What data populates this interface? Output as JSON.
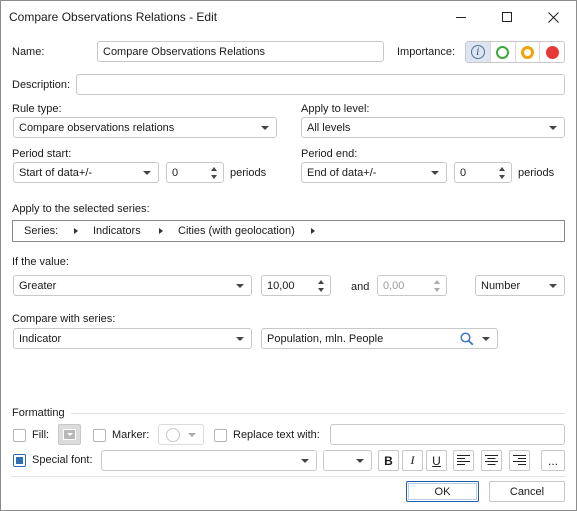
{
  "window": {
    "title": "Compare Observations Relations - Edit"
  },
  "name": {
    "label": "Name:",
    "value": "Compare Observations Relations"
  },
  "importance": {
    "label": "Importance:",
    "options": [
      "info",
      "low",
      "medium",
      "high"
    ],
    "colors": {
      "low": "#3aa83a",
      "medium": "#f0a30a",
      "high": "#e53935"
    }
  },
  "description": {
    "label": "Description:",
    "value": ""
  },
  "rule_type": {
    "label": "Rule type:",
    "value": "Compare observations relations"
  },
  "apply_to_level": {
    "label": "Apply to level:",
    "value": "All levels"
  },
  "period_start": {
    "label": "Period start:",
    "value": "Start of data+/-",
    "offset": "0",
    "unit": "periods"
  },
  "period_end": {
    "label": "Period end:",
    "value": "End of data+/-",
    "offset": "0",
    "unit": "periods"
  },
  "series": {
    "label": "Apply to the selected series:",
    "crumbs": [
      "Series:",
      "Indicators",
      "Cities (with geolocation)"
    ]
  },
  "if_value": {
    "label": "If the value:",
    "condition": "Greater",
    "value1": "10,00",
    "and_label": "and",
    "value2": "0,00",
    "type": "Number"
  },
  "compare": {
    "label": "Compare with series:",
    "dimension": "Indicator",
    "element": "Population, mln. People"
  },
  "formatting": {
    "label": "Formatting",
    "fill_label": "Fill:",
    "marker_label": "Marker:",
    "replace_label": "Replace text with:",
    "replace_value": "",
    "special_font_label": "Special font:",
    "special_font_checked": true,
    "bold": "B",
    "italic": "I",
    "underline": "U",
    "more": "..."
  },
  "buttons": {
    "ok": "OK",
    "cancel": "Cancel"
  }
}
